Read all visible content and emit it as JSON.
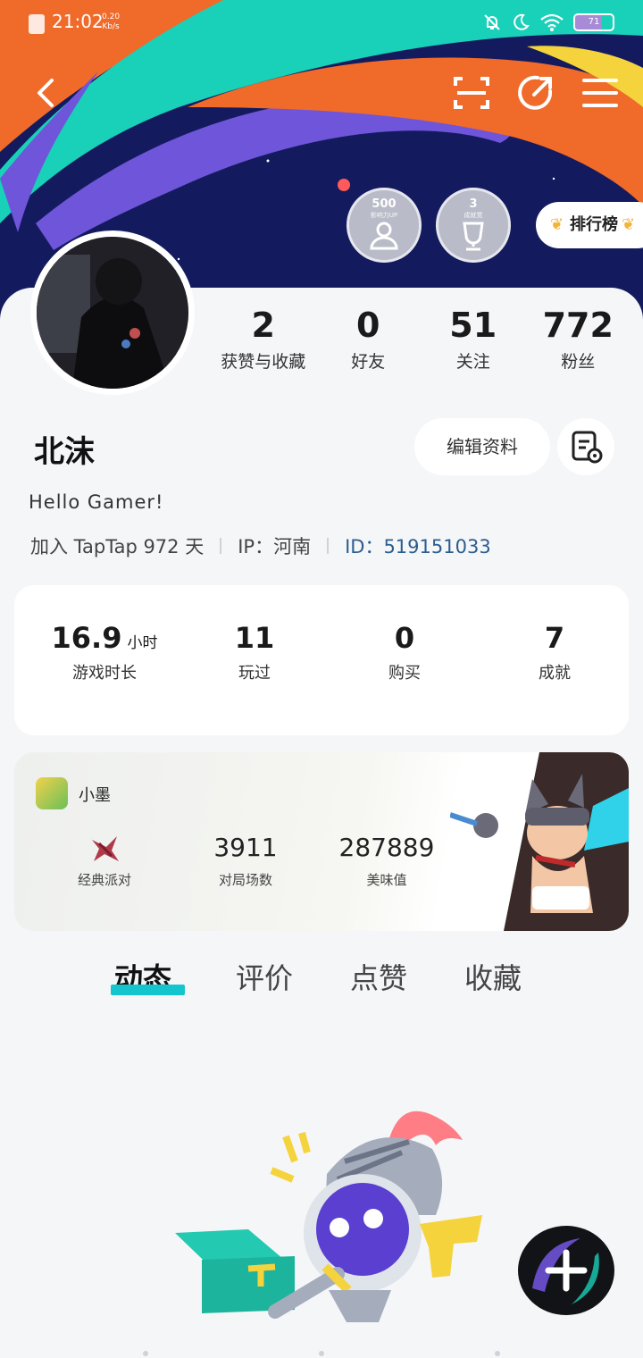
{
  "status_bar": {
    "time": "21:02",
    "speed_value": "0.20",
    "speed_unit": "Kb/s",
    "battery_level": "71"
  },
  "header": {
    "badges": [
      {
        "value": "500",
        "label": "影响力UP"
      },
      {
        "value": "3",
        "label": "成就党"
      }
    ],
    "rank_label": "排行榜"
  },
  "profile": {
    "nickname": "北沫",
    "bio": "Hello Gamer!",
    "join_text": "加入 TapTap 972 天",
    "ip_text": "IP：河南",
    "id_text": "ID：519151033",
    "edit_label": "编辑资料",
    "stats": [
      {
        "value": "2",
        "label": "获赞与收藏"
      },
      {
        "value": "0",
        "label": "好友"
      },
      {
        "value": "51",
        "label": "关注"
      },
      {
        "value": "772",
        "label": "粉丝"
      }
    ]
  },
  "game_stats": {
    "playtime_value": "16.9",
    "playtime_unit": "小时",
    "playtime_label": "游戏时长",
    "played_value": "11",
    "played_label": "玩过",
    "bought_value": "0",
    "bought_label": "购买",
    "achievements_value": "7",
    "achievements_label": "成就"
  },
  "game_card": {
    "name": "小墨",
    "mode_label": "经典派对",
    "matches_value": "3911",
    "matches_label": "对局场数",
    "taste_value": "287889",
    "taste_label": "美味值"
  },
  "tabs": [
    {
      "label": "动态",
      "active": true
    },
    {
      "label": "评价",
      "active": false
    },
    {
      "label": "点赞",
      "active": false
    },
    {
      "label": "收藏",
      "active": false
    }
  ],
  "colors": {
    "accent": "#15c5ce",
    "id_link": "#2b5d8f",
    "hero_bg": "#13195a"
  }
}
